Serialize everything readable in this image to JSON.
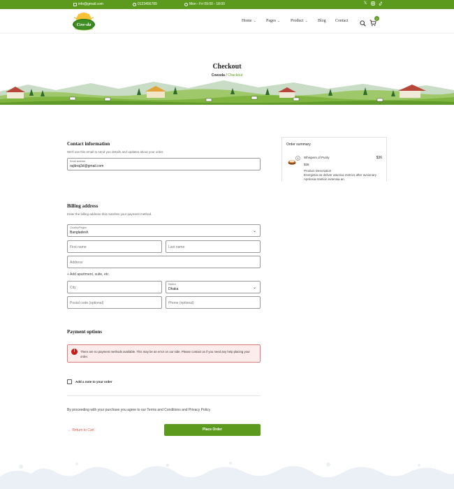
{
  "topbar": {
    "email": "info@gmail.com",
    "phone": "0123456789",
    "hours": "Mon - Fri 09:00 - 18:00",
    "social": [
      "x-icon",
      "instagram-icon",
      "tiktok-icon"
    ]
  },
  "header": {
    "logo_text": "Cow-da",
    "nav": [
      {
        "label": "Home",
        "has_dropdown": true
      },
      {
        "label": "Pages",
        "has_dropdown": true
      },
      {
        "label": "Product",
        "has_dropdown": true
      },
      {
        "label": "Blog",
        "has_dropdown": false
      },
      {
        "label": "Contact",
        "has_dropdown": false
      }
    ],
    "cart_count": "0"
  },
  "hero": {
    "title": "Checkout",
    "breadcrumb_home": "Cowsda",
    "breadcrumb_sep": " / ",
    "breadcrumb_current": "Checkout"
  },
  "contact": {
    "title": "Contact information",
    "description": "We'll use this email to send you details and updates about your order.",
    "email_label": "Email address",
    "email_value": "rajibraj3d@gmail.com"
  },
  "billing": {
    "title": "Billing address",
    "description": "Enter the billing address that matches your payment method.",
    "country_label": "Country/Region",
    "country_value": "Bangladesh",
    "first_name_ph": "First name",
    "last_name_ph": "Last name",
    "address_ph": "Address",
    "add_apartment": "+ Add apartment, suite, etc.",
    "city_ph": "City",
    "district_label": "District",
    "district_value": "Dhaka",
    "postal_ph": "Postal code (optional)",
    "phone_ph": "Phone (optional)"
  },
  "payment": {
    "title": "Payment options",
    "notice": "There are no payment methods available. This may be an error on our side. Please contact us if you need any help placing your order."
  },
  "note": {
    "label": "Add a note to your order"
  },
  "terms": "By proceeding with your purchase you agree to our Terms and Conditions and Privacy Policy",
  "actions": {
    "return_label": "Return to Cart",
    "place_order_label": "Place Order"
  },
  "summary": {
    "title": "Order summary",
    "item_qty": "1",
    "item_name": "Whispers of Purity",
    "item_total": "$36",
    "item_unit_price": "$36",
    "desc_title": "Product Description",
    "desc_text": "Energistia an deliver atactica metrics after avsionary Apnlosia trantion extensia an"
  },
  "colors": {
    "brand_green": "#5b9a1c",
    "error_red": "#cc1818",
    "link_red": "#e0584a"
  }
}
